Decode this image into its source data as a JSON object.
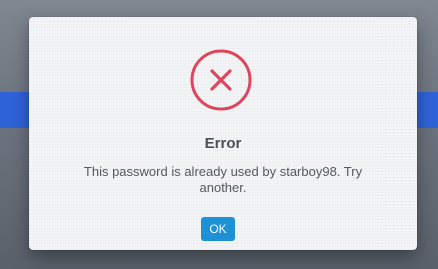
{
  "dialog": {
    "title": "Error",
    "message": "This password is already used by starboy98. Try another.",
    "icon": "error-circle-x-icon",
    "ok_label": "OK"
  },
  "colors": {
    "background_blue": "#2f63d8",
    "error_red": "#e0475e",
    "button_blue": "#1f93d7"
  }
}
